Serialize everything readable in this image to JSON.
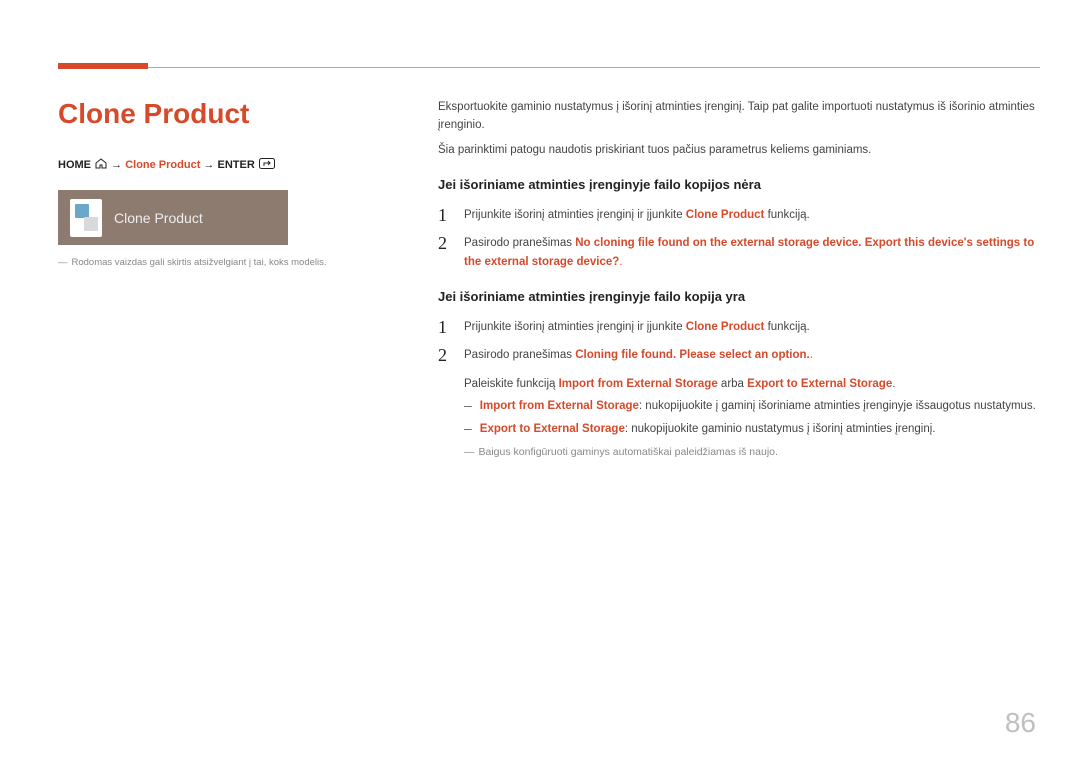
{
  "title": "Clone Product",
  "breadcrumb": {
    "home": "HOME",
    "arrow": "→",
    "clone": "Clone Product",
    "enter": "ENTER"
  },
  "menuPreview": {
    "label": "Clone Product"
  },
  "leftFootnote": "Rodomas vaizdas gali skirtis atsižvelgiant į tai, koks modelis.",
  "intro": {
    "p1": "Eksportuokite gaminio nustatymus į išorinį atminties įrenginį. Taip pat galite importuoti nustatymus iš išorinio atminties įrenginio.",
    "p2": "Šia parinktimi patogu naudotis priskiriant tuos pačius parametrus keliems gaminiams."
  },
  "sectionA": {
    "heading": "Jei išoriniame atminties įrenginyje failo kopijos nėra",
    "step1a": "Prijunkite išorinį atminties įrenginį ir įjunkite ",
    "step1b": "Clone Product",
    "step1c": " funkciją.",
    "step2a": "Pasirodo pranešimas ",
    "step2b": "No cloning file found on the external storage device. Export this device's settings to the external storage device?"
  },
  "sectionB": {
    "heading": "Jei išoriniame atminties įrenginyje failo kopija yra",
    "step1a": "Prijunkite išorinį atminties įrenginį ir įjunkite ",
    "step1b": "Clone Product",
    "step1c": " funkciją.",
    "step2a": "Pasirodo pranešimas ",
    "step2b": "Cloning file found. Please select an option.",
    "runLineA": "Paleiskite funkciją ",
    "runLineB": "Import from External Storage",
    "runLineC": " arba ",
    "runLineD": "Export to External Storage",
    "runLineE": ".",
    "bullet1a": "Import from External Storage",
    "bullet1b": ": nukopijuokite į gaminį išoriniame atminties įrenginyje išsaugotus nustatymus.",
    "bullet2a": "Export to External Storage",
    "bullet2b": ": nukopijuokite gaminio nustatymus į išorinį atminties įrenginį.",
    "endnote": "Baigus konfigūruoti gaminys automatiškai paleidžiamas iš naujo."
  },
  "pageNumber": "86"
}
